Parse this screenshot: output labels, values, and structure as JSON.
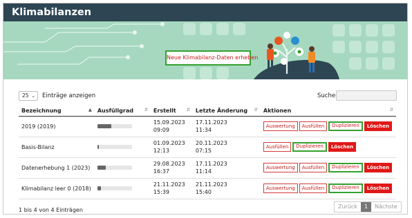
{
  "header": {
    "title": "Klimabilanzen"
  },
  "banner": {
    "cta_label": "Neue Klimabilanz-Daten erheben"
  },
  "controls": {
    "page_length": "25",
    "page_length_label": "Einträge anzeigen",
    "search_label": "Suchen",
    "search_value": ""
  },
  "table": {
    "columns": [
      "Bezeichnung",
      "Ausfüllgrad",
      "Erstellt",
      "Letzte Änderung",
      "Aktionen"
    ],
    "rows": [
      {
        "name": "2019 (2019)",
        "progress": 0.4,
        "created_date": "15.09.2023",
        "created_time": "09:09",
        "changed_date": "17.11.2023",
        "changed_time": "11:34"
      },
      {
        "name": "Basis-Bilanz",
        "progress": 0.05,
        "created_date": "01.09.2023",
        "created_time": "12:13",
        "changed_date": "20.11.2023",
        "changed_time": "07:15"
      },
      {
        "name": "Datenerhebung 1 (2023)",
        "progress": 0.25,
        "created_date": "29.08.2023",
        "created_time": "16:37",
        "changed_date": "17.11.2023",
        "changed_time": "11:14"
      },
      {
        "name": "Klimabilanz leer 0 (2018)",
        "progress": 0.1,
        "created_date": "21.11.2023",
        "created_time": "15:39",
        "changed_date": "21.11.2023",
        "changed_time": "15:40"
      }
    ],
    "actions": {
      "evaluate": "Auswertung",
      "fill": "Ausfüllen",
      "duplicate": "Duplizieren",
      "delete": "Löschen"
    }
  },
  "footer": {
    "info": "1 bis 4 von 4 Einträgen",
    "prev": "Zurück",
    "page": "1",
    "next": "Nächste"
  },
  "colors": {
    "header_bg": "#2e4554",
    "banner_bg": "#a6d8c0",
    "accent_red": "#c41d1d",
    "delete_red": "#e11818",
    "highlight_green": "#35a02f"
  }
}
